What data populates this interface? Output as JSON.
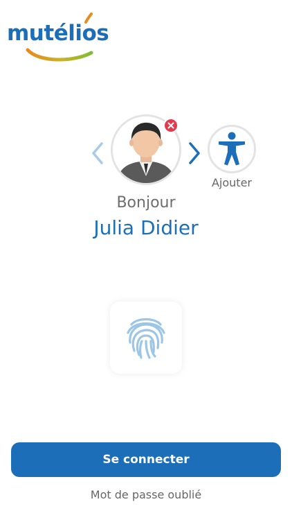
{
  "brand": {
    "logo_text": "mutélios",
    "color_primary": "#1c6eb8",
    "color_orange": "#e98a1e",
    "color_green": "#7cbc35"
  },
  "profile": {
    "greeting": "Bonjour",
    "name": "Julia Didier",
    "avatar_icon": "male-avatar-icon",
    "remove_icon": "close-icon",
    "prev_icon": "chevron-left-icon",
    "next_icon": "chevron-right-icon"
  },
  "add_profile": {
    "label": "Ajouter",
    "icon": "accessibility-person-icon"
  },
  "biometric": {
    "icon": "fingerprint-icon"
  },
  "actions": {
    "connect_label": "Se connecter",
    "forgot_password": "Mot de passe oublié"
  },
  "colors": {
    "remove_badge": "#e23b4e",
    "text_gray": "#6e6e6e",
    "fingerprint": "#9cc6e6"
  }
}
